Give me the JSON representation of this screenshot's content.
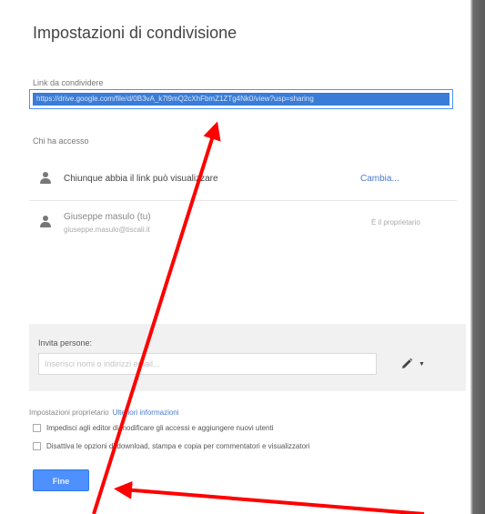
{
  "dialog": {
    "title": "Impostazioni di condivisione",
    "link_label": "Link da condividere",
    "link_value": "https://drive.google.com/file/d/0B3vA_k7l9mQ2cXhFbmZ1ZTg4Nk0/view?usp=sharing",
    "access_label": "Chi ha accesso",
    "access_rows": [
      {
        "text": "Chiunque abbia il link può visualizzare",
        "action": "Cambia..."
      },
      {
        "name": "Giuseppe masulo (tu)",
        "email": "giuseppe.masulo@tiscali.it",
        "role": "È il proprietario"
      }
    ],
    "invite": {
      "label": "Invita persone:",
      "placeholder": "Inserisci nomi o indirizzi email..."
    },
    "owner_settings": {
      "label": "Impostazioni proprietario",
      "link": "Ulteriori informazioni"
    },
    "options": [
      "Impedisci agli editor di modificare gli accessi e aggiungere nuovi utenti",
      "Disattiva le opzioni di download, stampa e copia per commentatori e visualizzatori"
    ],
    "done_label": "Fine"
  },
  "colors": {
    "accent": "#4d90fe",
    "link": "#4a7bd1",
    "annotation": "#ff0000"
  }
}
